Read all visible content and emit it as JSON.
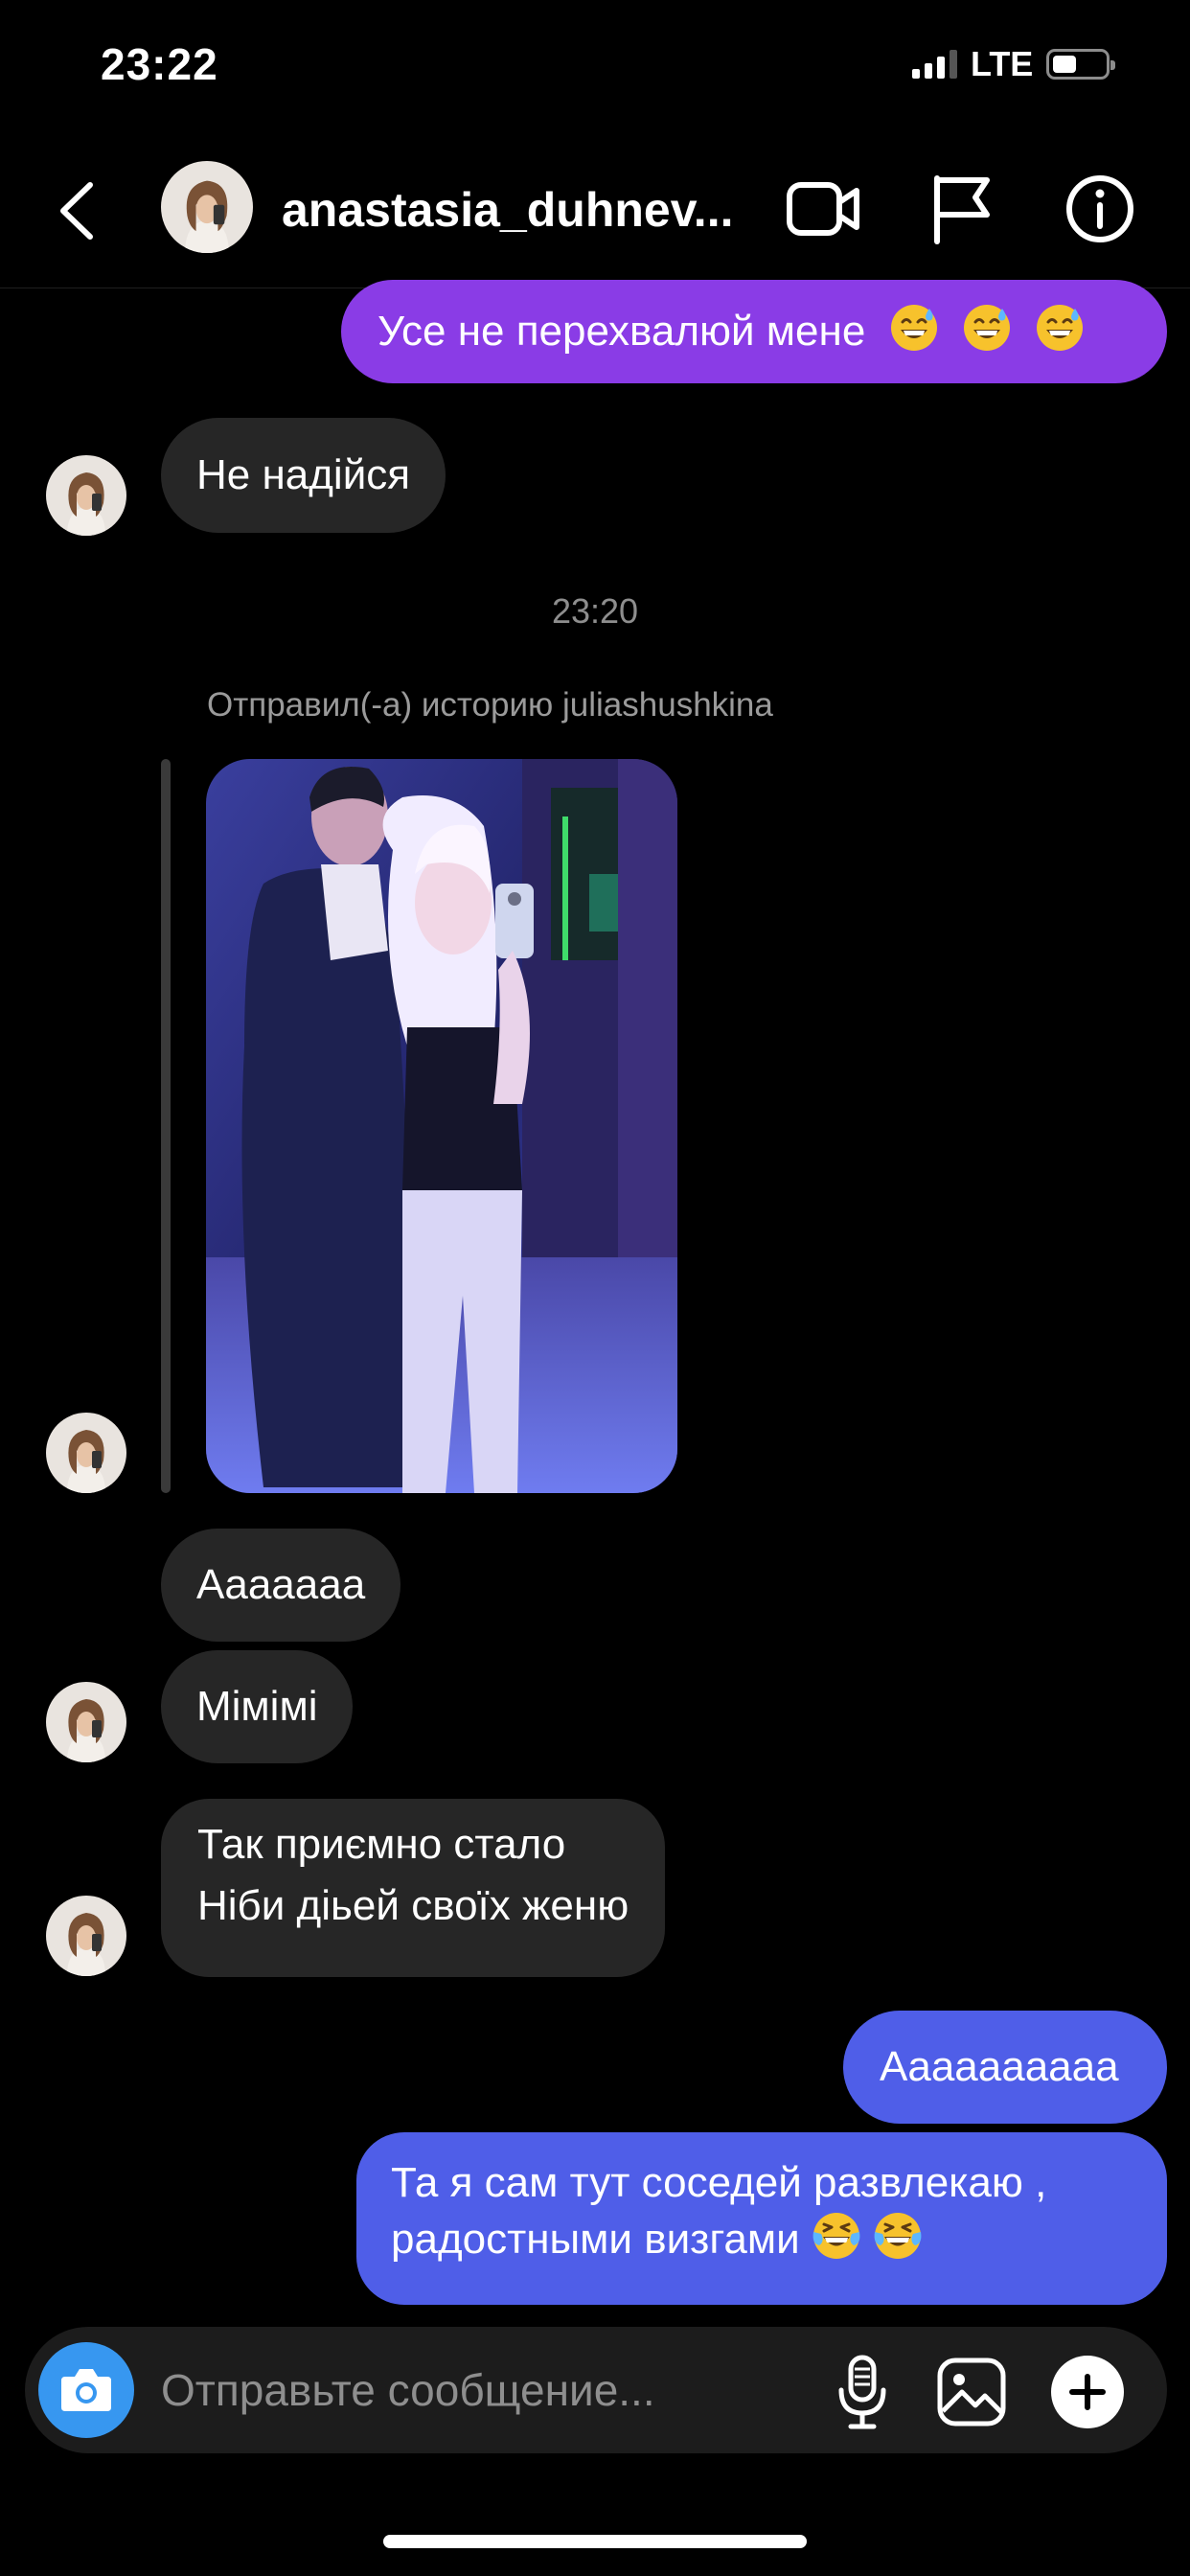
{
  "status_bar": {
    "time": "23:22",
    "network": "LTE"
  },
  "header": {
    "username": "anastasia_duhnev..."
  },
  "messages": {
    "m1": "Усе не перехвалюй мене",
    "m2": "Не надійся",
    "timestamp": "23:20",
    "story_caption": "Отправил(-а) историю juliashushkina",
    "m3": "Аaaaaaa",
    "m4": "Мімімі",
    "m5_line1": "Так приємно стало",
    "m5_line2": "Ніби діьей своїх женю",
    "m6": "Аaaaaaaaaa",
    "m7_line1": "Та я сам тут соседей развлекаю ,",
    "m7_line2": "радостными визгами"
  },
  "composer": {
    "placeholder": "Отправьте сообщение..."
  },
  "colors": {
    "incoming_bubble": "#262626",
    "purple_bubble": "#8a3ce6",
    "blue_bubble": "#4f5ee8",
    "camera_button": "#3797f0"
  },
  "icons": {
    "back": "chevron-left-icon",
    "video": "video-camera-icon",
    "flag": "flag-icon",
    "info": "info-icon",
    "camera": "camera-icon",
    "mic": "microphone-icon",
    "gallery": "gallery-icon",
    "add": "plus-icon",
    "sweat_smile": "sweat-smile-emoji",
    "joy": "joy-emoji"
  }
}
